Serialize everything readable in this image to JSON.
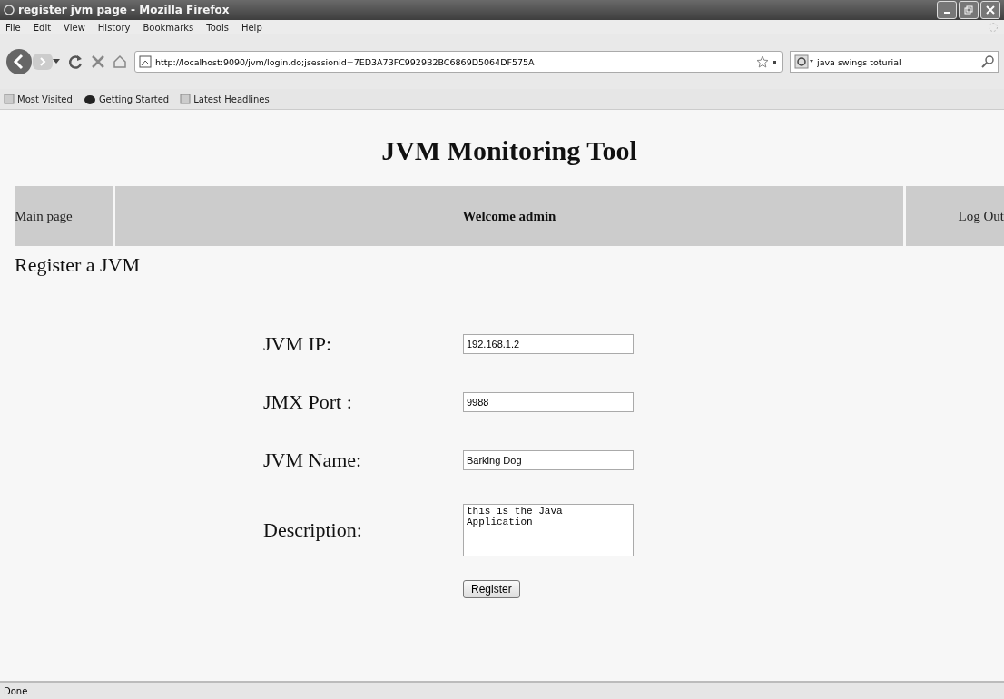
{
  "window": {
    "title": "register jvm page - Mozilla Firefox"
  },
  "menu": [
    "File",
    "Edit",
    "View",
    "History",
    "Bookmarks",
    "Tools",
    "Help"
  ],
  "address_bar": {
    "value": "http://localhost:9090/jvm/login.do;jsessionid=7ED3A73FC9929B2BC6869D5064DF575A"
  },
  "search": {
    "value": "java swings toturial"
  },
  "bookmarks": [
    "Most Visited",
    "Getting Started",
    "Latest Headlines"
  ],
  "page": {
    "heading": "JVM Monitoring Tool",
    "nav": {
      "left_link": "Main page",
      "welcome": "Welcome admin",
      "right_link": "Log Out"
    },
    "section_title": "Register a JVM",
    "fields": [
      {
        "label": "JVM IP:",
        "kind": "text",
        "value": "192.168.1.2"
      },
      {
        "label": "JMX Port :",
        "kind": "text",
        "value": "9988"
      },
      {
        "label": "JVM Name:",
        "kind": "text",
        "value": "Barking Dog"
      },
      {
        "label": "Description:",
        "kind": "textarea",
        "value": "this is the Java Application"
      }
    ],
    "submit": "Register"
  },
  "status_bar": "Done"
}
